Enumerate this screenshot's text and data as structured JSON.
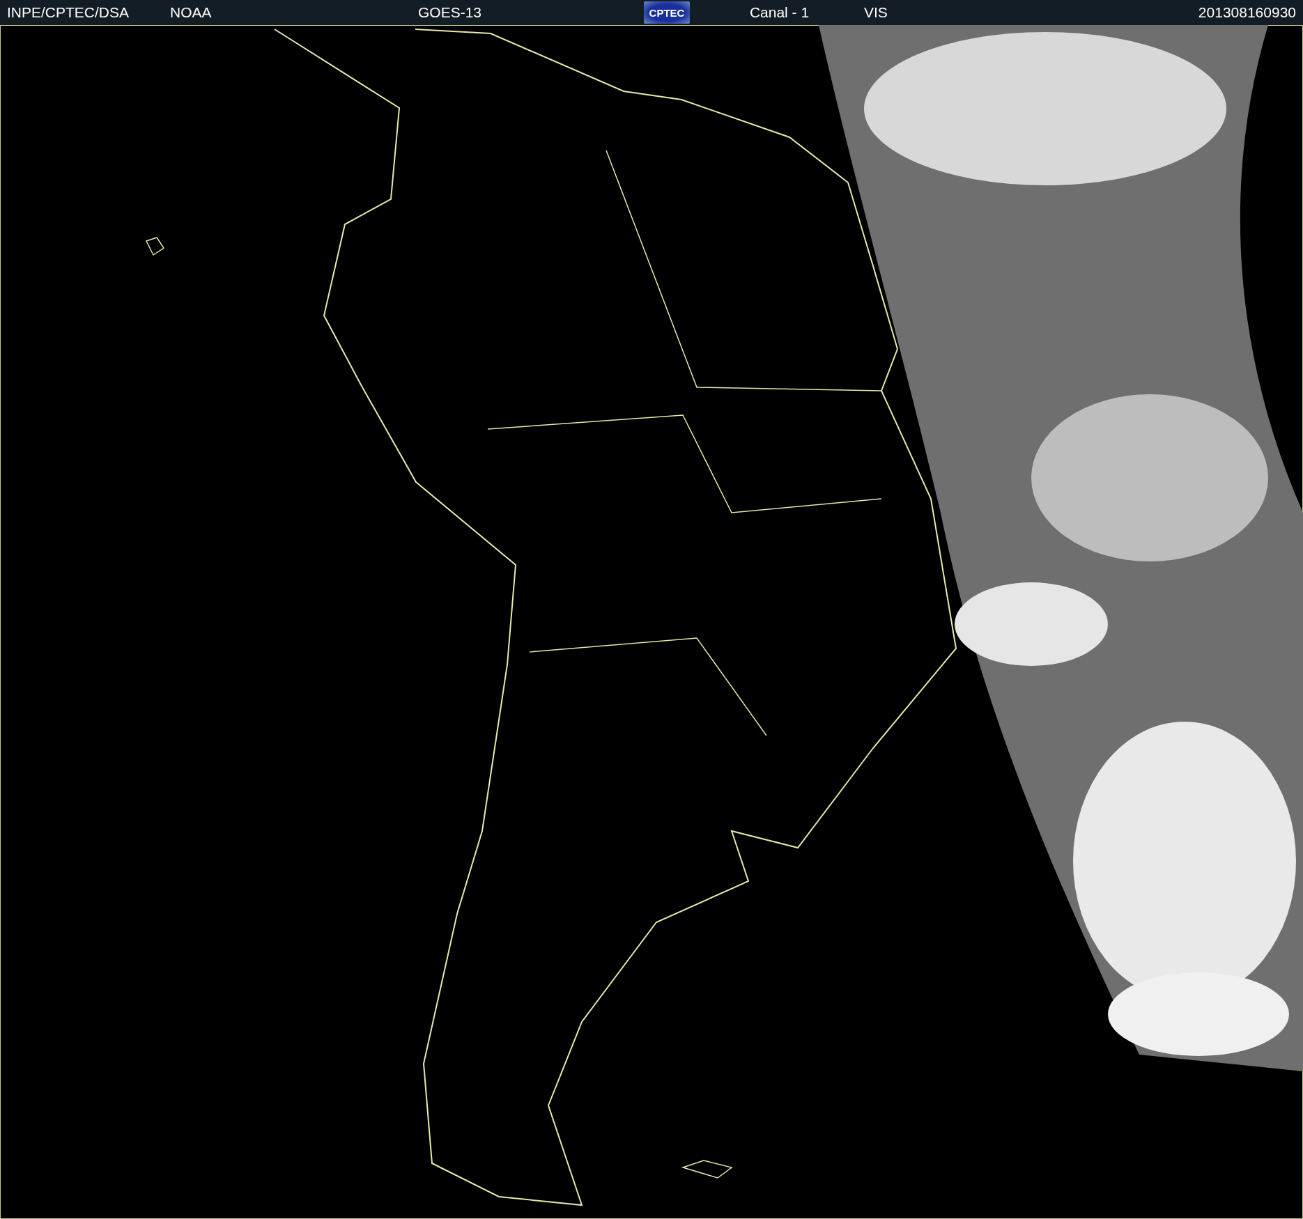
{
  "header": {
    "source": "INPE/CPTEC/DSA",
    "agency": "NOAA",
    "satellite": "GOES-13",
    "logo_text": "CPTEC",
    "channel": "Canal - 1",
    "band": "VIS",
    "timestamp": "201308160930"
  }
}
